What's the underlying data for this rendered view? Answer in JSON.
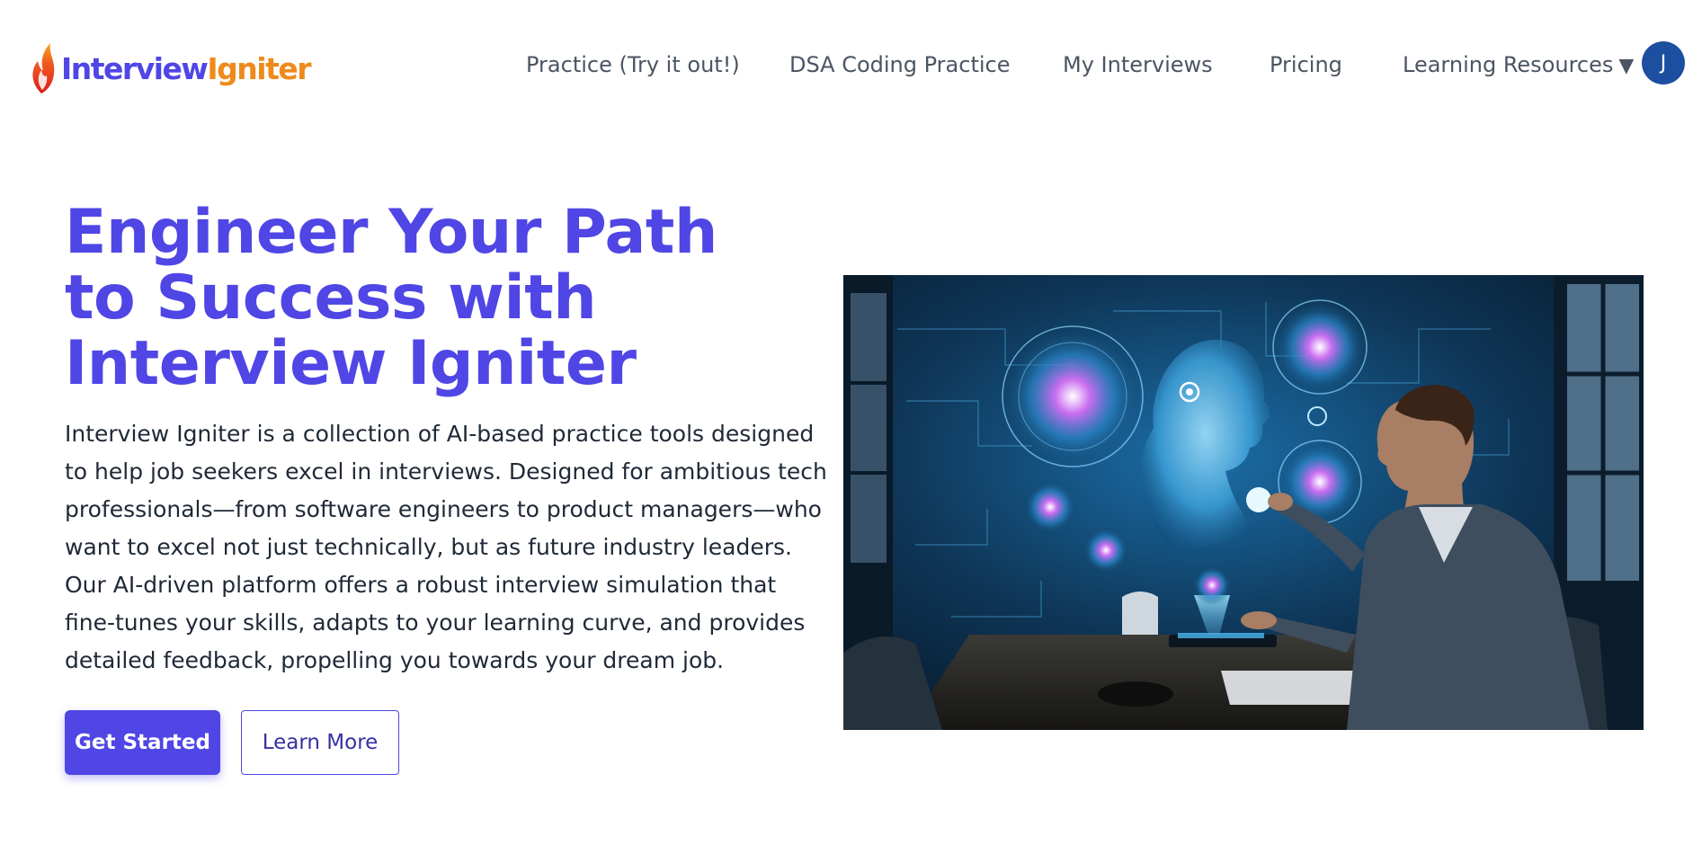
{
  "header": {
    "logo": {
      "text_part1": "Interview",
      "text_part2": "Igniter",
      "icon": "flame-icon"
    },
    "nav": [
      {
        "label": "Practice (Try it out!)"
      },
      {
        "label": "DSA Coding Practice"
      },
      {
        "label": "My Interviews"
      },
      {
        "label": "Pricing"
      },
      {
        "label": "Learning Resources",
        "has_dropdown": true,
        "caret": "▼"
      }
    ],
    "avatar": {
      "initial": "J",
      "color": "#1d4fa0"
    }
  },
  "hero": {
    "title": "Engineer Your Path to Success with Interview Igniter",
    "description": "Interview Igniter is a collection of AI-based practice tools designed to help job seekers excel in interviews. Designed for ambitious tech professionals—from software engineers to product managers—who want to excel not just technically, but as future industry leaders. Our AI-driven platform offers a robust interview simulation that fine-tunes your skills, adapts to your learning curve, and provides detailed feedback, propelling you towards your dream job.",
    "primary_button": "Get Started",
    "secondary_button": "Learn More",
    "image_subject": "AI hologram interview illustration"
  },
  "colors": {
    "accent": "#4f46e5",
    "logo_orange": "#ee8a1b",
    "nav_text": "#4b5563",
    "body_text": "#1f2937"
  }
}
